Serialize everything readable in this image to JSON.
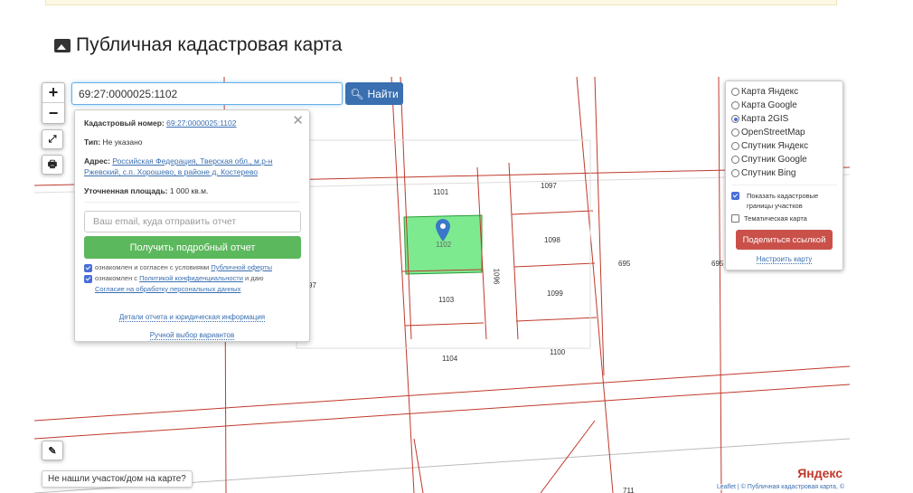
{
  "page": {
    "title": "Публичная кадастровая карта"
  },
  "search": {
    "value": "69:27:0000025:1102",
    "button": "Найти"
  },
  "zoom": {
    "in": "+",
    "out": "−"
  },
  "popup": {
    "cad_label": "Кадастровый номер:",
    "cad_value": "69:27:0000025:1102",
    "type_label": "Тип:",
    "type_value": "Не указано",
    "addr_label": "Адрес:",
    "addr_value": "Российская Федерация, Тверская обл., м.р-н Ржевский, с.п. Хорошево, в районе д. Костерево",
    "area_label": "Уточненная площадь:",
    "area_value": "1 000 кв.м.",
    "email_placeholder": "Ваш email, куда отправить отчет",
    "get_report": "Получить подробный отчет",
    "agree1_text": "ознакомлен и согласен с условиями",
    "agree1_link": "Публичной оферты",
    "agree2_text": "ознакомлен с",
    "agree2_link": "Политикой конфиденциальности",
    "agree2_mid": "и даю",
    "agree2_link2": "Согласие на обработку персональных данных",
    "details": "Детали отчета и юридическая информация",
    "manual": "Ручной выбор вариантов"
  },
  "layers": {
    "options": [
      {
        "label": "Карта Яндекс",
        "selected": false
      },
      {
        "label": "Карта Google",
        "selected": false
      },
      {
        "label": "Карта 2GIS",
        "selected": true
      },
      {
        "label": "OpenStreetMap",
        "selected": false
      },
      {
        "label": "Спутник Яндекс",
        "selected": false
      },
      {
        "label": "Спутник Google",
        "selected": false
      },
      {
        "label": "Спутник Bing",
        "selected": false
      }
    ],
    "show_borders": "Показать кадастровые границы участков",
    "show_borders_checked": true,
    "thematic": "Тематическая карта",
    "thematic_checked": false,
    "share": "Поделиться ссылкой",
    "configure": "Настроить карту"
  },
  "parcels": [
    "1101",
    "1097",
    "1102",
    "1098",
    "1096",
    "695",
    "695",
    "1103",
    "1099",
    "97",
    "1104",
    "1100",
    "711"
  ],
  "help": "Не нашли участок/дом на карте?",
  "attribution": {
    "leaflet": "Leaflet",
    "text": "| © Публичная кадастровая карта, ©",
    "logo": "Яндекс"
  },
  "colors": {
    "parcel_line": "#c0392b",
    "selected_parcel": "#7dea8f",
    "find_button": "#3a6fb0",
    "report_button": "#5cb85c",
    "share_button": "#c9514a"
  }
}
